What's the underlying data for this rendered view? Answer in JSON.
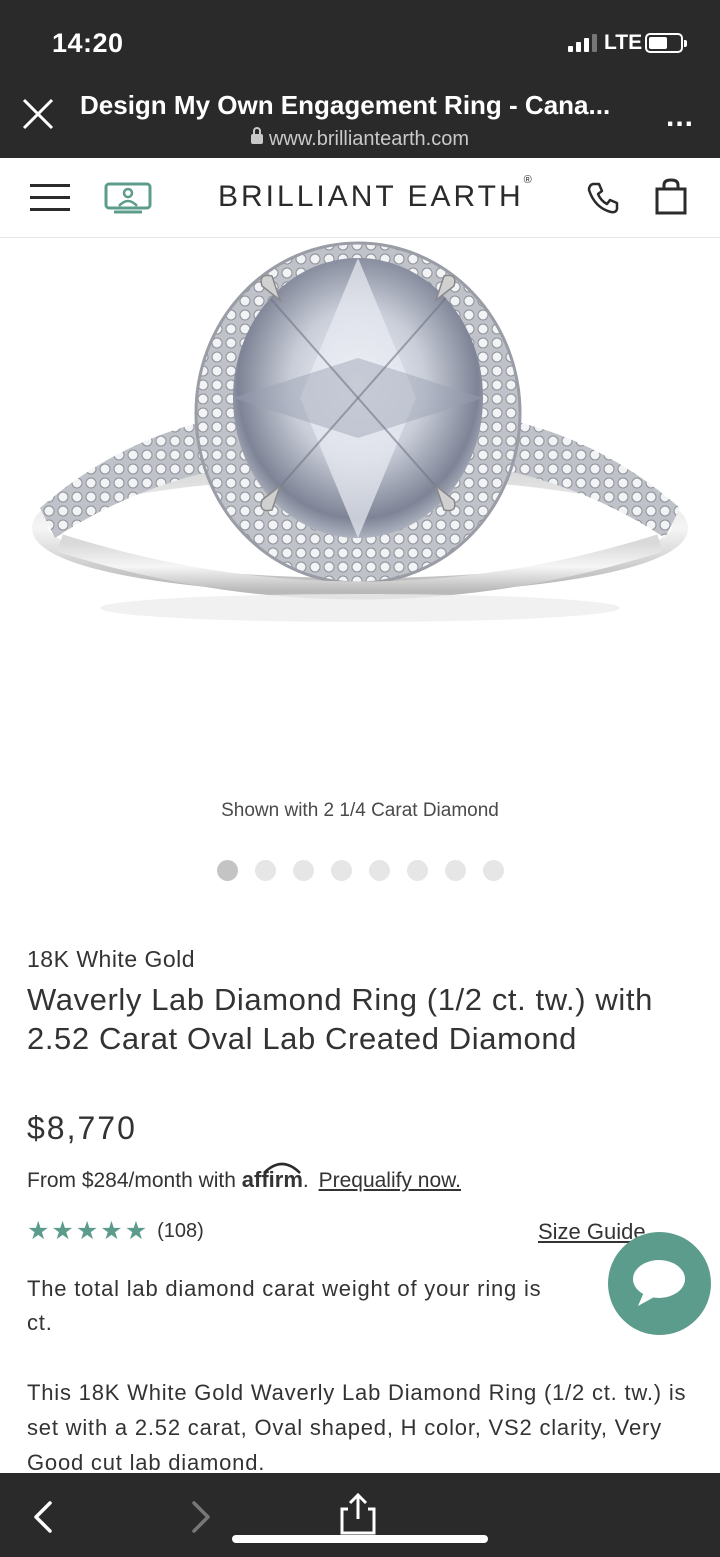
{
  "status_bar": {
    "time": "14:20",
    "network": "LTE"
  },
  "browser": {
    "page_title": "Design My Own Engagement Ring - Cana...",
    "url": "www.brilliantearth.com",
    "more": "..."
  },
  "header": {
    "brand": "BRILLIANT EARTH",
    "brand_mark": "®"
  },
  "product": {
    "image_caption": "Shown with 2 1/4 Carat Diamond",
    "carousel_total": 8,
    "carousel_active": 1,
    "metal": "18K White Gold",
    "name": "Waverly Lab Diamond Ring (1/2 ct. tw.) with 2.52 Carat Oval Lab Created Diamond",
    "price": "$8,770",
    "financing_prefix": "From $284/month with",
    "affirm": "affirm",
    "affirm_suffix": ".",
    "prequalify_link": "Prequalify now.",
    "rating_stars": 5,
    "review_count": "(108)",
    "size_guide": "Size Guide",
    "desc_carat": "The total lab diamond carat weight of your ring is",
    "desc_carat_end": "ct.",
    "description": "This 18K White Gold Waverly Lab Diamond Ring (1/2 ct. tw.) is set with a 2.52 carat, Oval shaped, H color, VS2 clarity, Very Good cut lab diamond."
  },
  "colors": {
    "accent": "#5c9c8c",
    "chrome": "#2a2a2a"
  },
  "icons": [
    "close-icon",
    "lock-icon",
    "more-icon",
    "hamburger-icon",
    "video-icon",
    "phone-icon",
    "bag-icon",
    "star-icon",
    "chat-icon",
    "back-icon",
    "forward-icon",
    "share-icon"
  ]
}
